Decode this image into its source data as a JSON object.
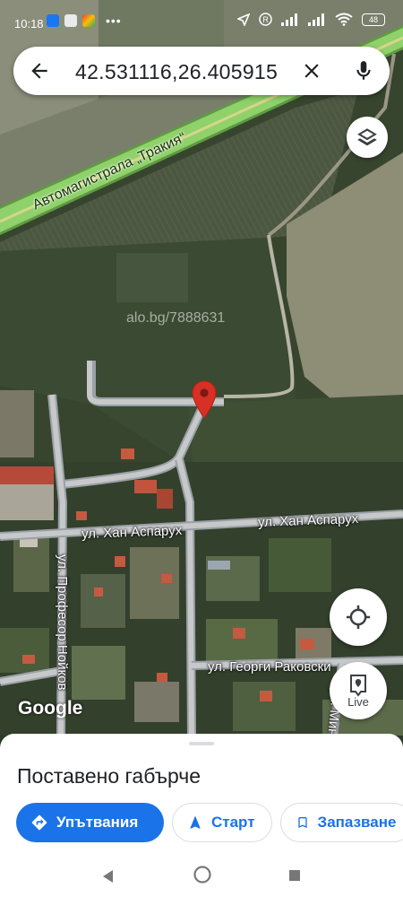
{
  "status_bar": {
    "time": "10:18",
    "dots": "•••",
    "battery": "48"
  },
  "search": {
    "query": "42.531116,26.405915"
  },
  "map": {
    "watermark": "alo.bg/7888631",
    "logo": "Google",
    "labels": {
      "highway": "Автомагистрала „Тракия“",
      "han_asparuh_1": "ул. Хан Аспарух",
      "han_asparuh_2": "ул. Хан Аспарух",
      "profesor": "ул. Професор Нойков",
      "georgi": "ул. Георги Раковски",
      "vertical_right": "ул. Минту"
    },
    "pin_color": "#d93025",
    "highway_color": "#8fd16a"
  },
  "map_controls": {
    "live_label": "Live"
  },
  "place_sheet": {
    "title": "Поставено габърче",
    "actions": [
      {
        "label": "Упътвания",
        "icon": "directions-icon"
      },
      {
        "label": "Старт",
        "icon": "navigation-arrow-icon"
      },
      {
        "label": "Запазване",
        "icon": "bookmark-icon"
      }
    ]
  },
  "accent_color": "#1a73e8"
}
